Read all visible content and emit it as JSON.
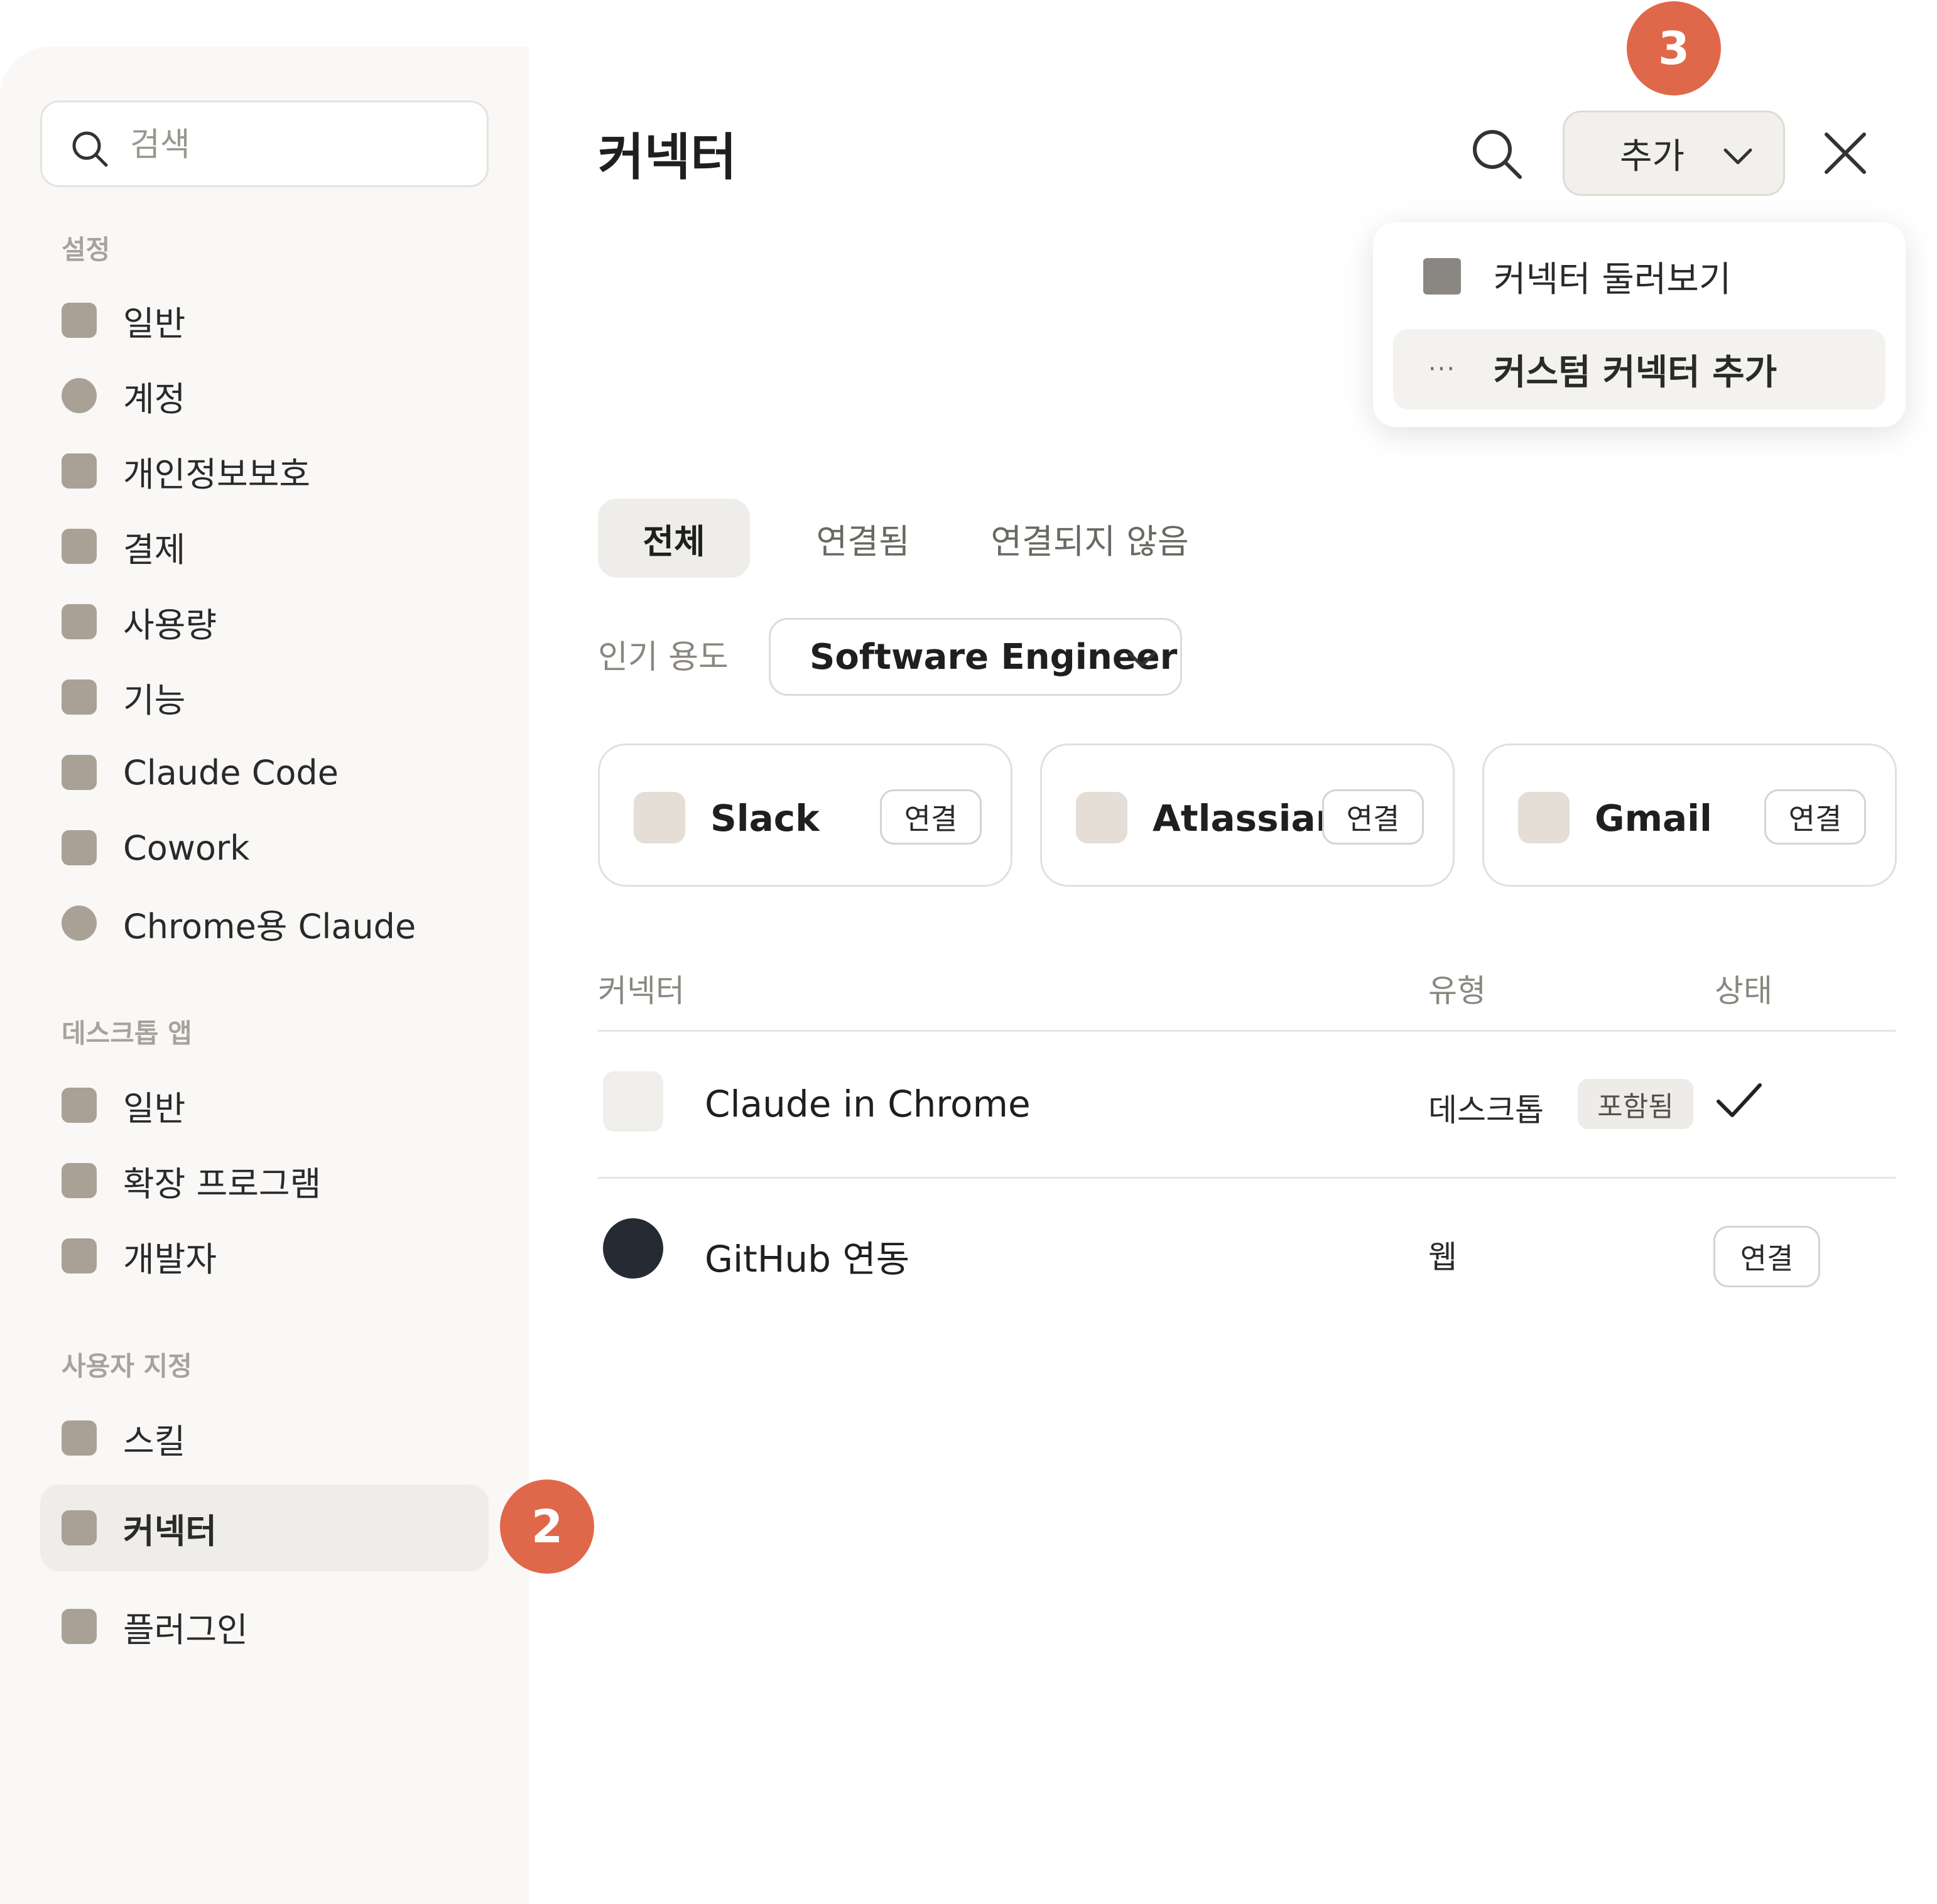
{
  "sidebar": {
    "search": {
      "placeholder": "검색"
    },
    "sections": [
      {
        "title": "설정",
        "items": [
          {
            "label": "일반",
            "icon": "gear-icon"
          },
          {
            "label": "계정",
            "icon": "user-circle-icon"
          },
          {
            "label": "개인정보보호",
            "icon": "lock-icon"
          },
          {
            "label": "결제",
            "icon": "credit-card-icon"
          },
          {
            "label": "사용량",
            "icon": "chart-icon"
          },
          {
            "label": "기능",
            "icon": "sparkle-icon"
          },
          {
            "label": "Claude Code",
            "icon": "code-icon"
          },
          {
            "label": "Cowork",
            "icon": "cowork-icon"
          },
          {
            "label": "Chrome용 Claude",
            "icon": "chrome-icon"
          }
        ]
      },
      {
        "title": "데스크톱 앱",
        "items": [
          {
            "label": "일반",
            "icon": "gear-icon"
          },
          {
            "label": "확장 프로그램",
            "icon": "puzzle-icon"
          },
          {
            "label": "개발자",
            "icon": "terminal-icon"
          }
        ]
      },
      {
        "title": "사용자 지정",
        "items": [
          {
            "label": "스킬",
            "icon": "skill-icon"
          },
          {
            "label": "커넥터",
            "icon": "connector-icon",
            "active": true
          },
          {
            "label": "플러그인",
            "icon": "plugin-icon"
          }
        ]
      }
    ]
  },
  "badges": {
    "step2": "2",
    "step3": "3",
    "color": "#e0684a"
  },
  "header": {
    "title": "커넥터",
    "add_label": "추가"
  },
  "add_menu": {
    "items": [
      {
        "label": "커넥터 둘러보기",
        "icon": "grid-icon"
      },
      {
        "label": "커스텀 커넥터 추가",
        "icon": "ellipsis-icon",
        "hover": true
      }
    ]
  },
  "tabs": [
    {
      "label": "전체",
      "active": true
    },
    {
      "label": "연결됨"
    },
    {
      "label": "연결되지 않음"
    }
  ],
  "filter": {
    "label": "인기 용도",
    "value": "Software Engineer"
  },
  "popular_connectors": [
    {
      "name": "Slack",
      "action": "연결"
    },
    {
      "name": "Atlassian",
      "action": "연결"
    },
    {
      "name": "Gmail",
      "action": "연결"
    }
  ],
  "table": {
    "columns": {
      "name": "커넥터",
      "type": "유형",
      "status": "상태"
    },
    "rows": [
      {
        "name": "Claude in Chrome",
        "type": "데스크톱",
        "badge": "포함됨",
        "status": "connected"
      },
      {
        "name": "GitHub 연동",
        "type": "웹",
        "action": "연결"
      }
    ]
  }
}
